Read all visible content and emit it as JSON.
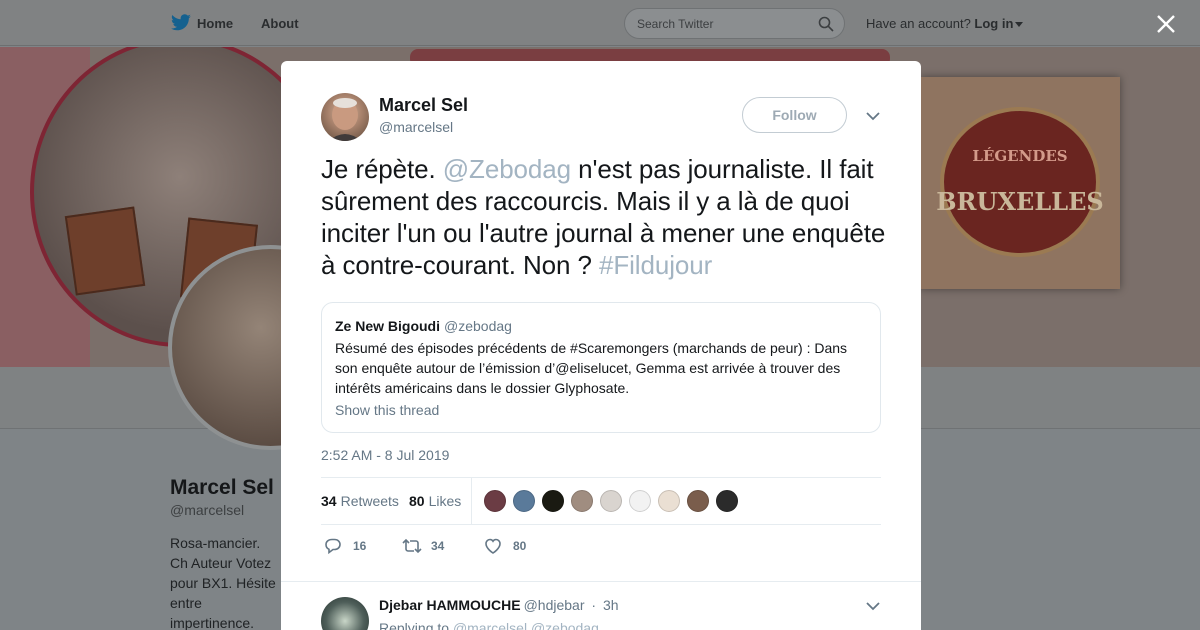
{
  "topnav": {
    "home_label": "Home",
    "about_label": "About",
    "search_placeholder": "Search Twitter",
    "account_prompt": "Have an account?",
    "login_label": "Log in"
  },
  "background_profile": {
    "name": "Marcel Sel",
    "handle": "@marcelsel",
    "bio": "Rosa-mancier. Ch Auteur Votez pour BX1. Hésite entre impertinence.",
    "poster_title": "BRUXELLES",
    "poster_subtitle": "LÉGENDES"
  },
  "tweet": {
    "author_name": "Marcel Sel",
    "author_handle": "@marcelsel",
    "follow_label": "Follow",
    "text_part1": "Je répète. ",
    "mention": "@Zebodag",
    "text_part2": " n'est pas journaliste. Il fait sûrement des raccourcis. Mais il y a là de quoi inciter l'un ou l'autre journal à mener une enquête à contre-courant. Non ? ",
    "hashtag": "#Fildujour",
    "timestamp": "2:52 AM - 8 Jul 2019",
    "retweets_count": "34",
    "retweets_label": "Retweets",
    "likes_count": "80",
    "likes_label": "Likes",
    "reply_action_count": "16",
    "retweet_action_count": "34",
    "like_action_count": "80"
  },
  "quoted_tweet": {
    "author_name": "Ze New Bigoudi",
    "author_handle": "@zebodag",
    "text": "Résumé des épisodes précédents de #Scaremongers (marchands de peur) : Dans son enquête autour de l’émission d’@eliselucet, Gemma est arrivée à trouver des intérêts américains dans le dossier Glyphosate.",
    "thread_link": "Show this thread"
  },
  "reply": {
    "author_name": "Djebar HAMMOUCHE",
    "author_handle": "@hdjebar",
    "separator": "·",
    "age": "3h",
    "replying_prefix": "Replying to",
    "replying_handles": "@marcelsel @zebodag"
  },
  "colors": {
    "link": "#a3b4c2",
    "secondary_text": "#657786",
    "twitter_blue": "#1da1f2",
    "overlay": "#7f8487"
  },
  "likers": [
    {
      "icon": "liker-avatar-1",
      "color": "#6b3c44"
    },
    {
      "icon": "liker-avatar-2",
      "color": "#5a7a9a"
    },
    {
      "icon": "liker-avatar-3",
      "color": "#1a1a12"
    },
    {
      "icon": "liker-avatar-4",
      "color": "#a08d80"
    },
    {
      "icon": "liker-avatar-5",
      "color": "#d9d4cf"
    },
    {
      "icon": "liker-avatar-6",
      "color": "#f2f2f2"
    },
    {
      "icon": "liker-avatar-7",
      "color": "#eadfd3"
    },
    {
      "icon": "liker-avatar-8",
      "color": "#7a5d4c"
    },
    {
      "icon": "liker-avatar-9",
      "color": "#2b2b2b"
    }
  ]
}
